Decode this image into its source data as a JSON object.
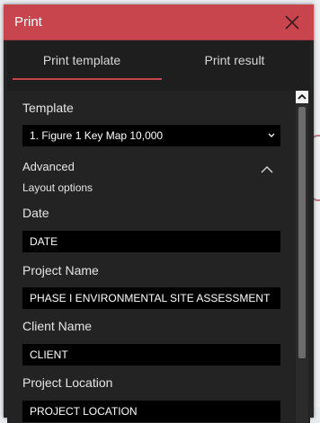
{
  "dialog": {
    "title": "Print",
    "close_icon": "close-icon"
  },
  "tabs": [
    {
      "label": "Print template",
      "active": true
    },
    {
      "label": "Print result",
      "active": false
    }
  ],
  "template": {
    "label": "Template",
    "selected": "1. Figure 1 Key Map 10,000"
  },
  "advanced": {
    "label": "Advanced",
    "expanded": true,
    "section_label": "Layout options"
  },
  "fields": {
    "date": {
      "label": "Date",
      "value": "DATE"
    },
    "project_name": {
      "label": "Project Name",
      "value": "PHASE I ENVIRONMENTAL SITE ASSESSMENT"
    },
    "client_name": {
      "label": "Client Name",
      "value": "CLIENT"
    },
    "project_location": {
      "label": "Project Location",
      "value": "PROJECT LOCATION"
    }
  },
  "colors": {
    "accent": "#c8454e",
    "panel_bg": "#242424",
    "input_bg": "#000000"
  }
}
